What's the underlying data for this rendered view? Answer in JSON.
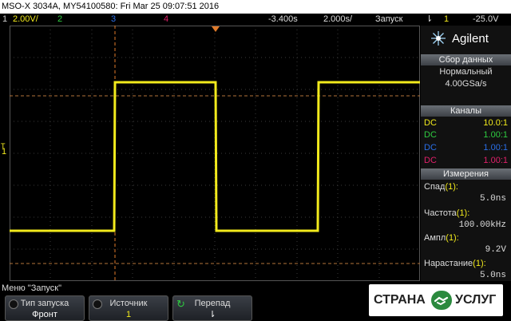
{
  "title_bar": {
    "text": "MSO-X 3034A, MY54100580: Fri Mar 25 09:07:51 2016"
  },
  "status_bar": {
    "ch1_label": "1",
    "ch1_scale": "2.00V/",
    "ch2_label": "2",
    "ch3_label": "3",
    "ch4_label": "4",
    "offset": "-3.400s",
    "timebase": "2.000s/",
    "run_state": "Запуск",
    "trigger_symbol": "⇂",
    "trigger_channel": "1",
    "trigger_level": "-25.0V",
    "colors": {
      "ch1": "#f2ea1c",
      "ch2": "#2ecc40",
      "ch3": "#2a6fe8",
      "ch4": "#e0206a"
    }
  },
  "screen": {
    "ground_marker": "1",
    "trigger_marker_label": "T"
  },
  "panel": {
    "brand": "Agilent",
    "acquisition_header": "Сбор данных",
    "acquisition_mode": "Нормальный",
    "sample_rate": "4.00GSa/s",
    "channels_header": "Каналы",
    "channels": [
      {
        "coupling": "DC",
        "probe": "10.0:1",
        "color": "#f2ea1c"
      },
      {
        "coupling": "DC",
        "probe": "1.00:1",
        "color": "#2ecc40"
      },
      {
        "coupling": "DC",
        "probe": "1.00:1",
        "color": "#2a6fe8"
      },
      {
        "coupling": "DC",
        "probe": "1.00:1",
        "color": "#e0206a"
      }
    ],
    "measurements_header": "Измерения",
    "measurements": [
      {
        "label": "Спад",
        "channel": "(1):",
        "value": "5.0ns"
      },
      {
        "label": "Частота",
        "channel": "(1):",
        "value": "100.00kHz"
      },
      {
        "label": "Ампл",
        "channel": "(1):",
        "value": "9.2V"
      },
      {
        "label": "Нарастание",
        "channel": "(1):",
        "value": "5.0ns"
      }
    ]
  },
  "menu": {
    "title": "Меню \"Запуск\"",
    "softkeys": [
      {
        "label": "Тип запуска",
        "value": "Фронт"
      },
      {
        "label": "Источник",
        "value": "1"
      },
      {
        "label": "Перепад",
        "value": "⇂"
      }
    ]
  },
  "badge": {
    "left": "СТРАНА",
    "right": "УСЛУГ"
  }
}
